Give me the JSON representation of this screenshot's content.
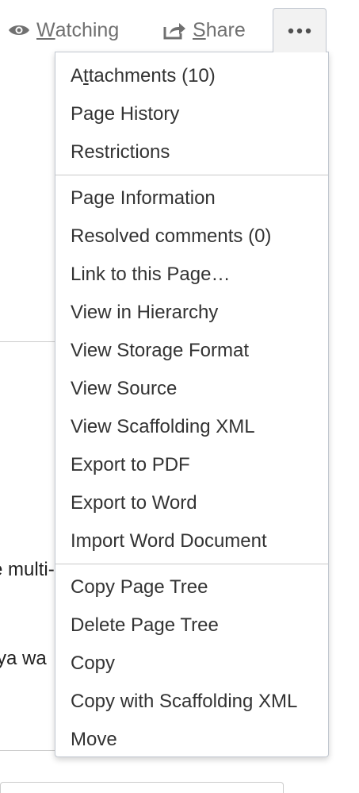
{
  "toolbar": {
    "watching_prefix": "",
    "watching_mnemonic": "W",
    "watching_rest": "atching",
    "share_mnemonic": "S",
    "share_rest": "hare",
    "more_label": "•••"
  },
  "background": {
    "text_fragment_1": "e multi-",
    "text_fragment_2": "ya wa"
  },
  "menu": {
    "attachments_a": "A",
    "attachments_t": "t",
    "attachments_rest": "tachments (10)",
    "page_history": "Page History",
    "restrictions": "Restrictions",
    "page_information": "Page Information",
    "resolved_comments": "Resolved comments (0)",
    "link_to_page": "Link to this Page…",
    "view_in_hierarchy": "View in Hierarchy",
    "view_storage_format": "View Storage Format",
    "view_source": "View Source",
    "view_scaffolding_xml": "View Scaffolding XML",
    "export_pdf": "Export to PDF",
    "export_word": "Export to Word",
    "import_word": "Import Word Document",
    "copy_page_tree": "Copy Page Tree",
    "delete_page_tree": "Delete Page Tree",
    "copy": "Copy",
    "copy_scaffolding": "Copy with Scaffolding XML",
    "move": "Move"
  },
  "colors": {
    "toolbar_text": "#707070",
    "menu_text": "#333333",
    "border": "#c1c7d0"
  }
}
